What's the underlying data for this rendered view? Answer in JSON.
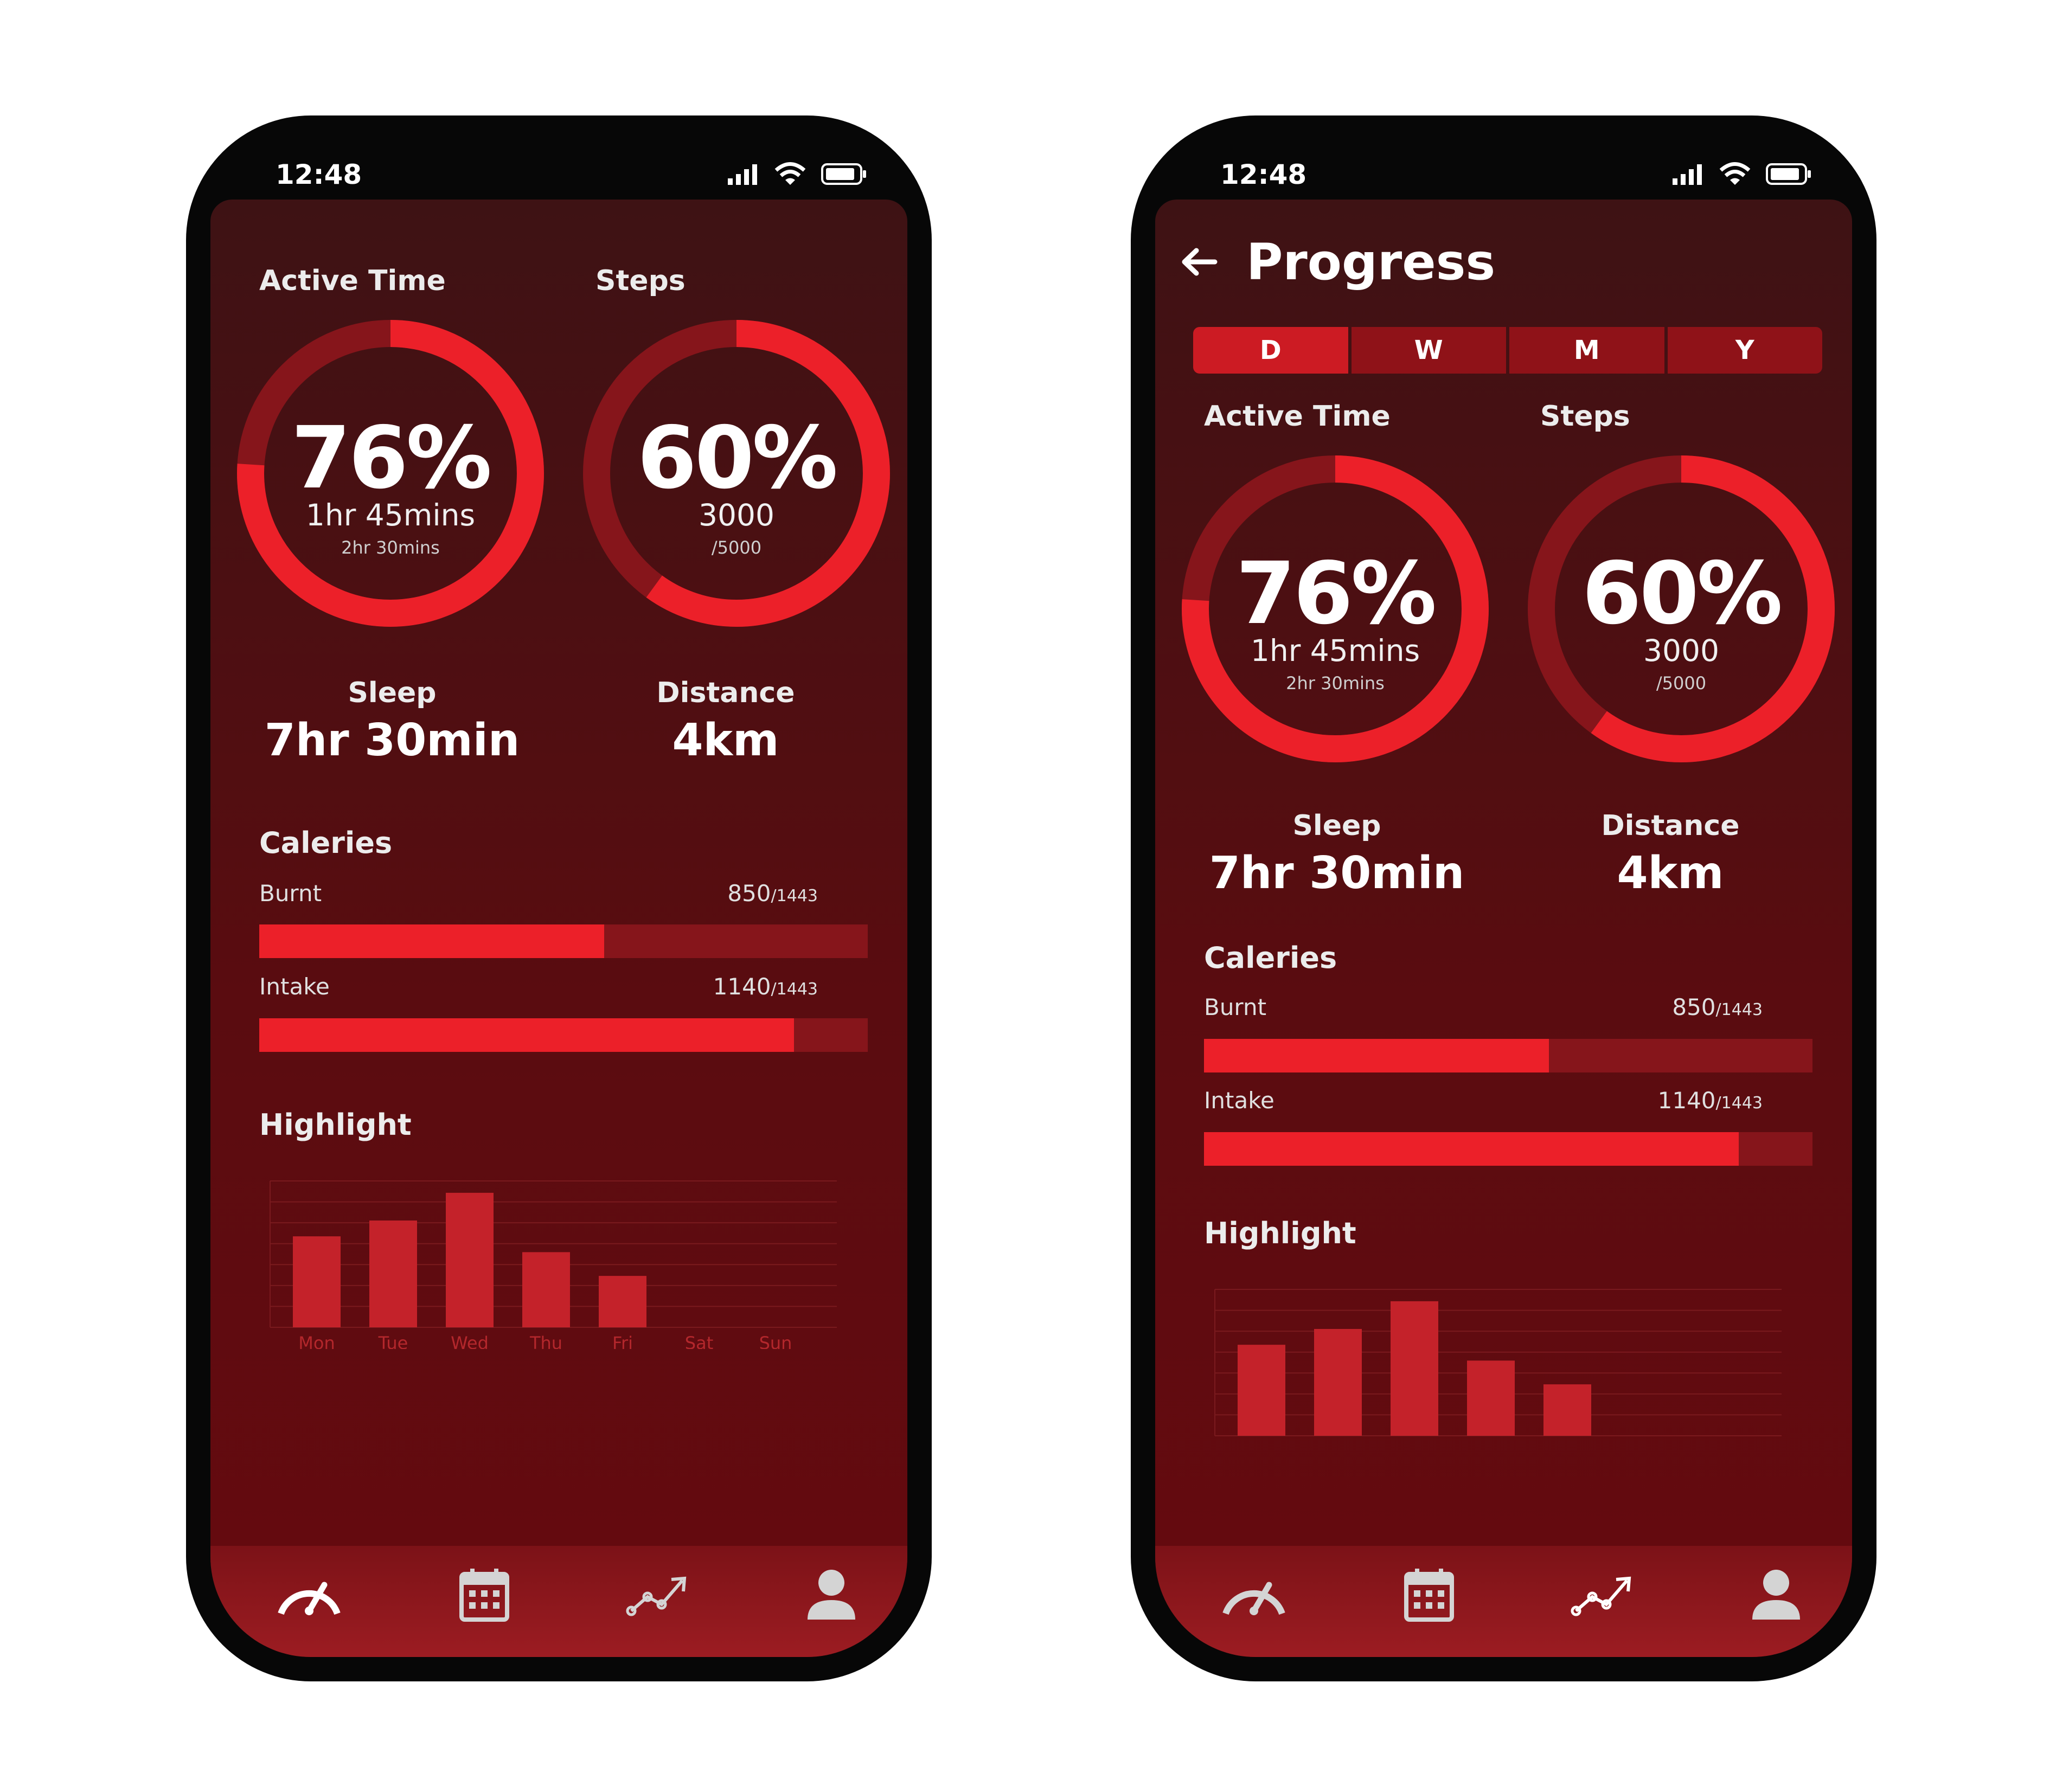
{
  "colors": {
    "accent": "#ec2029",
    "accent_dark": "#86151b",
    "bar": "#c4222a",
    "background_top": "#3e1214",
    "background_bottom": "#660a0f"
  },
  "status": {
    "time": "12:48",
    "icons": [
      "signal-icon",
      "wifi-icon",
      "battery-icon"
    ]
  },
  "left": {
    "active_time": {
      "label": "Active Time",
      "percent": "76%",
      "value": "1hr 45mins",
      "goal": "2hr 30mins",
      "progress": 0.76
    },
    "steps": {
      "label": "Steps",
      "percent": "60%",
      "value": "3000",
      "goal": "/5000",
      "progress": 0.6
    },
    "sleep": {
      "label": "Sleep",
      "value": "7hr 30min"
    },
    "distance": {
      "label": "Distance",
      "value": "4km"
    },
    "calories": {
      "title": "Caleries",
      "burnt": {
        "label": "Burnt",
        "value": "850",
        "total": "/1443",
        "progress": 0.567
      },
      "intake": {
        "label": "Intake",
        "value": "1140",
        "total": "/1443",
        "progress": 0.879
      }
    },
    "highlight": {
      "title": "Highlight"
    }
  },
  "right": {
    "header": {
      "back_icon": "arrow-left-icon",
      "title": "Progress"
    },
    "tabs": [
      {
        "label": "D"
      },
      {
        "label": "W"
      },
      {
        "label": "M"
      },
      {
        "label": "Y"
      }
    ],
    "active_time": {
      "label": "Active Time",
      "percent": "76%",
      "value": "1hr 45mins",
      "goal": "2hr 30mins",
      "progress": 0.76
    },
    "steps": {
      "label": "Steps",
      "percent": "60%",
      "value": "3000",
      "goal": "/5000",
      "progress": 0.6
    },
    "sleep": {
      "label": "Sleep",
      "value": "7hr 30min"
    },
    "distance": {
      "label": "Distance",
      "value": "4km"
    },
    "calories": {
      "title": "Caleries",
      "burnt": {
        "label": "Burnt",
        "value": "850",
        "total": "/1443",
        "progress": 0.567
      },
      "intake": {
        "label": "Intake",
        "value": "1140",
        "total": "/1443",
        "progress": 0.879
      }
    },
    "highlight": {
      "title": "Highlight"
    }
  },
  "nav": {
    "items": [
      "speedometer-icon",
      "calendar-icon",
      "trend-icon",
      "user-icon"
    ]
  },
  "chart_data": {
    "type": "bar",
    "categories": [
      "Mon",
      "Tue",
      "Wed",
      "Thu",
      "Fri",
      "Sat",
      "Sun"
    ],
    "values": [
      4.6,
      5.4,
      6.8,
      3.8,
      2.6,
      0,
      0
    ],
    "ylim": [
      0,
      7.4
    ],
    "grid": true,
    "title": "",
    "xlabel": "",
    "ylabel": ""
  }
}
